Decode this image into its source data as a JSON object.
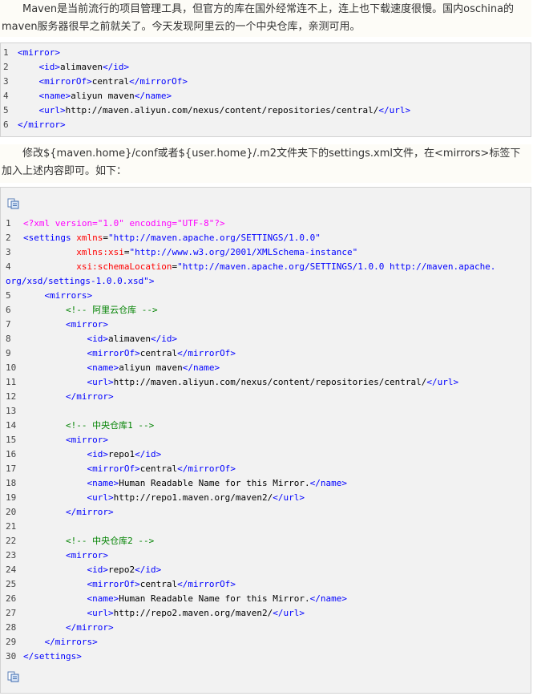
{
  "intro": {
    "text": "Maven是当前流行的项目管理工具，但官方的库在国外经常连不上，连上也下载速度很慢。国内oschina的maven服务器很早之前就关了。今天发现阿里云的一个中央仓库，亲测可用。"
  },
  "snippet1": {
    "lines": [
      {
        "n": "1",
        "indent": "",
        "parts": [
          [
            "br",
            "<"
          ],
          [
            "tag",
            "mirror"
          ],
          [
            "br",
            ">"
          ]
        ]
      },
      {
        "n": "2",
        "indent": "    ",
        "parts": [
          [
            "br",
            "<"
          ],
          [
            "tag",
            "id"
          ],
          [
            "br",
            ">"
          ],
          [
            "txt",
            "alimaven"
          ],
          [
            "br",
            "</"
          ],
          [
            "tag",
            "id"
          ],
          [
            "br",
            ">"
          ]
        ]
      },
      {
        "n": "3",
        "indent": "    ",
        "parts": [
          [
            "br",
            "<"
          ],
          [
            "tag",
            "mirrorOf"
          ],
          [
            "br",
            ">"
          ],
          [
            "txt",
            "central"
          ],
          [
            "br",
            "</"
          ],
          [
            "tag",
            "mirrorOf"
          ],
          [
            "br",
            ">"
          ]
        ]
      },
      {
        "n": "4",
        "indent": "    ",
        "parts": [
          [
            "br",
            "<"
          ],
          [
            "tag",
            "name"
          ],
          [
            "br",
            ">"
          ],
          [
            "txt",
            "aliyun maven"
          ],
          [
            "br",
            "</"
          ],
          [
            "tag",
            "name"
          ],
          [
            "br",
            ">"
          ]
        ]
      },
      {
        "n": "5",
        "indent": "    ",
        "parts": [
          [
            "br",
            "<"
          ],
          [
            "tag",
            "url"
          ],
          [
            "br",
            ">"
          ],
          [
            "txt",
            "http://maven.aliyun.com/nexus/content/repositories/central/"
          ],
          [
            "br",
            "</"
          ],
          [
            "tag",
            "url"
          ],
          [
            "br",
            ">"
          ]
        ]
      },
      {
        "n": "6",
        "indent": "",
        "parts": [
          [
            "br",
            "</"
          ],
          [
            "tag",
            "mirror"
          ],
          [
            "br",
            ">"
          ]
        ]
      }
    ]
  },
  "instruction": {
    "text": "修改${maven.home}/conf或者${user.home}/.m2文件夹下的settings.xml文件，在<mirrors>标签下加入上述内容即可。如下："
  },
  "icons": {
    "top": "copy-code-icon",
    "bottom": "copy-code-icon"
  },
  "snippet2": {
    "lines": [
      {
        "n": "1",
        "indent": "",
        "parts": [
          [
            "dec",
            "<?xml version=\"1.0\" encoding=\"UTF-8\"?>"
          ]
        ]
      },
      {
        "n": "2",
        "indent": "",
        "parts": [
          [
            "br",
            "<"
          ],
          [
            "tag",
            "settings"
          ],
          [
            "txt",
            " "
          ],
          [
            "att",
            "xmlns"
          ],
          [
            "txt",
            "="
          ],
          [
            "val",
            "\"http://maven.apache.org/SETTINGS/1.0.0\""
          ]
        ]
      },
      {
        "n": "3",
        "indent": "          ",
        "parts": [
          [
            "att",
            "xmlns:xsi"
          ],
          [
            "txt",
            "="
          ],
          [
            "val",
            "\"http://www.w3.org/2001/XMLSchema-instance\""
          ]
        ]
      },
      {
        "n": "4",
        "indent": "          ",
        "parts": [
          [
            "att",
            "xsi:schemaLocation"
          ],
          [
            "txt",
            "="
          ],
          [
            "val",
            "\"http://maven.apache.org/SETTINGS/1.0.0 http://maven.apache."
          ]
        ]
      },
      {
        "n": "",
        "indent": "",
        "cont": true,
        "parts": [
          [
            "val",
            "org/xsd/settings-1.0.0.xsd\""
          ],
          [
            "br",
            ">"
          ]
        ]
      },
      {
        "n": "5",
        "indent": "    ",
        "parts": [
          [
            "br",
            "<"
          ],
          [
            "tag",
            "mirrors"
          ],
          [
            "br",
            ">"
          ]
        ]
      },
      {
        "n": "6",
        "indent": "        ",
        "parts": [
          [
            "cmt",
            "<!-- 阿里云仓库 -->"
          ]
        ]
      },
      {
        "n": "7",
        "indent": "        ",
        "parts": [
          [
            "br",
            "<"
          ],
          [
            "tag",
            "mirror"
          ],
          [
            "br",
            ">"
          ]
        ]
      },
      {
        "n": "8",
        "indent": "            ",
        "parts": [
          [
            "br",
            "<"
          ],
          [
            "tag",
            "id"
          ],
          [
            "br",
            ">"
          ],
          [
            "txt",
            "alimaven"
          ],
          [
            "br",
            "</"
          ],
          [
            "tag",
            "id"
          ],
          [
            "br",
            ">"
          ]
        ]
      },
      {
        "n": "9",
        "indent": "            ",
        "parts": [
          [
            "br",
            "<"
          ],
          [
            "tag",
            "mirrorOf"
          ],
          [
            "br",
            ">"
          ],
          [
            "txt",
            "central"
          ],
          [
            "br",
            "</"
          ],
          [
            "tag",
            "mirrorOf"
          ],
          [
            "br",
            ">"
          ]
        ]
      },
      {
        "n": "10",
        "indent": "            ",
        "parts": [
          [
            "br",
            "<"
          ],
          [
            "tag",
            "name"
          ],
          [
            "br",
            ">"
          ],
          [
            "txt",
            "aliyun maven"
          ],
          [
            "br",
            "</"
          ],
          [
            "tag",
            "name"
          ],
          [
            "br",
            ">"
          ]
        ]
      },
      {
        "n": "11",
        "indent": "            ",
        "parts": [
          [
            "br",
            "<"
          ],
          [
            "tag",
            "url"
          ],
          [
            "br",
            ">"
          ],
          [
            "txt",
            "http://maven.aliyun.com/nexus/content/repositories/central/"
          ],
          [
            "br",
            "</"
          ],
          [
            "tag",
            "url"
          ],
          [
            "br",
            ">"
          ]
        ]
      },
      {
        "n": "12",
        "indent": "        ",
        "parts": [
          [
            "br",
            "</"
          ],
          [
            "tag",
            "mirror"
          ],
          [
            "br",
            ">"
          ]
        ]
      },
      {
        "n": "13",
        "indent": "",
        "parts": []
      },
      {
        "n": "14",
        "indent": "        ",
        "parts": [
          [
            "cmt",
            "<!-- 中央仓库1 -->"
          ]
        ]
      },
      {
        "n": "15",
        "indent": "        ",
        "parts": [
          [
            "br",
            "<"
          ],
          [
            "tag",
            "mirror"
          ],
          [
            "br",
            ">"
          ]
        ]
      },
      {
        "n": "16",
        "indent": "            ",
        "parts": [
          [
            "br",
            "<"
          ],
          [
            "tag",
            "id"
          ],
          [
            "br",
            ">"
          ],
          [
            "txt",
            "repo1"
          ],
          [
            "br",
            "</"
          ],
          [
            "tag",
            "id"
          ],
          [
            "br",
            ">"
          ]
        ]
      },
      {
        "n": "17",
        "indent": "            ",
        "parts": [
          [
            "br",
            "<"
          ],
          [
            "tag",
            "mirrorOf"
          ],
          [
            "br",
            ">"
          ],
          [
            "txt",
            "central"
          ],
          [
            "br",
            "</"
          ],
          [
            "tag",
            "mirrorOf"
          ],
          [
            "br",
            ">"
          ]
        ]
      },
      {
        "n": "18",
        "indent": "            ",
        "parts": [
          [
            "br",
            "<"
          ],
          [
            "tag",
            "name"
          ],
          [
            "br",
            ">"
          ],
          [
            "txt",
            "Human Readable Name for this Mirror."
          ],
          [
            "br",
            "</"
          ],
          [
            "tag",
            "name"
          ],
          [
            "br",
            ">"
          ]
        ]
      },
      {
        "n": "19",
        "indent": "            ",
        "parts": [
          [
            "br",
            "<"
          ],
          [
            "tag",
            "url"
          ],
          [
            "br",
            ">"
          ],
          [
            "txt",
            "http://repo1.maven.org/maven2/"
          ],
          [
            "br",
            "</"
          ],
          [
            "tag",
            "url"
          ],
          [
            "br",
            ">"
          ]
        ]
      },
      {
        "n": "20",
        "indent": "        ",
        "parts": [
          [
            "br",
            "</"
          ],
          [
            "tag",
            "mirror"
          ],
          [
            "br",
            ">"
          ]
        ]
      },
      {
        "n": "21",
        "indent": "",
        "parts": []
      },
      {
        "n": "22",
        "indent": "        ",
        "parts": [
          [
            "cmt",
            "<!-- 中央仓库2 -->"
          ]
        ]
      },
      {
        "n": "23",
        "indent": "        ",
        "parts": [
          [
            "br",
            "<"
          ],
          [
            "tag",
            "mirror"
          ],
          [
            "br",
            ">"
          ]
        ]
      },
      {
        "n": "24",
        "indent": "            ",
        "parts": [
          [
            "br",
            "<"
          ],
          [
            "tag",
            "id"
          ],
          [
            "br",
            ">"
          ],
          [
            "txt",
            "repo2"
          ],
          [
            "br",
            "</"
          ],
          [
            "tag",
            "id"
          ],
          [
            "br",
            ">"
          ]
        ]
      },
      {
        "n": "25",
        "indent": "            ",
        "parts": [
          [
            "br",
            "<"
          ],
          [
            "tag",
            "mirrorOf"
          ],
          [
            "br",
            ">"
          ],
          [
            "txt",
            "central"
          ],
          [
            "br",
            "</"
          ],
          [
            "tag",
            "mirrorOf"
          ],
          [
            "br",
            ">"
          ]
        ]
      },
      {
        "n": "26",
        "indent": "            ",
        "parts": [
          [
            "br",
            "<"
          ],
          [
            "tag",
            "name"
          ],
          [
            "br",
            ">"
          ],
          [
            "txt",
            "Human Readable Name for this Mirror."
          ],
          [
            "br",
            "</"
          ],
          [
            "tag",
            "name"
          ],
          [
            "br",
            ">"
          ]
        ]
      },
      {
        "n": "27",
        "indent": "            ",
        "parts": [
          [
            "br",
            "<"
          ],
          [
            "tag",
            "url"
          ],
          [
            "br",
            ">"
          ],
          [
            "txt",
            "http://repo2.maven.org/maven2/"
          ],
          [
            "br",
            "</"
          ],
          [
            "tag",
            "url"
          ],
          [
            "br",
            ">"
          ]
        ]
      },
      {
        "n": "28",
        "indent": "        ",
        "parts": [
          [
            "br",
            "</"
          ],
          [
            "tag",
            "mirror"
          ],
          [
            "br",
            ">"
          ]
        ]
      },
      {
        "n": "29",
        "indent": "    ",
        "parts": [
          [
            "br",
            "</"
          ],
          [
            "tag",
            "mirrors"
          ],
          [
            "br",
            ">"
          ]
        ]
      },
      {
        "n": "30",
        "indent": "",
        "parts": [
          [
            "br",
            "</"
          ],
          [
            "tag",
            "settings"
          ],
          [
            "br",
            ">"
          ]
        ]
      }
    ]
  }
}
